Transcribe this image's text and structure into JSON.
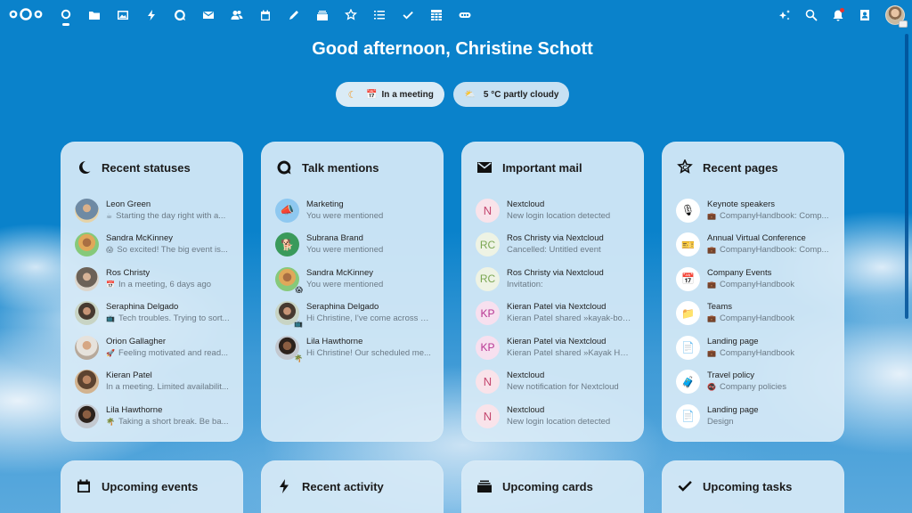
{
  "header": {
    "logo": "nextcloud-logo",
    "apps": [
      {
        "name": "dashboard",
        "icon": "dashboard-icon",
        "active": true
      },
      {
        "name": "files",
        "icon": "folder-icon"
      },
      {
        "name": "photos",
        "icon": "image-icon"
      },
      {
        "name": "activity",
        "icon": "lightning-icon"
      },
      {
        "name": "talk",
        "icon": "talk-icon"
      },
      {
        "name": "mail",
        "icon": "mail-icon"
      },
      {
        "name": "contacts",
        "icon": "contacts-icon"
      },
      {
        "name": "calendar",
        "icon": "calendar-icon"
      },
      {
        "name": "notes",
        "icon": "pencil-icon"
      },
      {
        "name": "deck",
        "icon": "deck-icon"
      },
      {
        "name": "collectives",
        "icon": "collectives-icon"
      },
      {
        "name": "tasks-list",
        "icon": "list-icon"
      },
      {
        "name": "tasks",
        "icon": "check-icon"
      },
      {
        "name": "tables",
        "icon": "table-icon"
      },
      {
        "name": "integrations",
        "icon": "link-icon"
      }
    ],
    "right": [
      "assistant-icon",
      "search-icon",
      "bell-icon",
      "contacts-menu-icon",
      "user-avatar"
    ]
  },
  "greeting": "Good afternoon, Christine Schott",
  "status": {
    "status_label": "In a meeting",
    "weather_label": "5 °C partly cloudy"
  },
  "widgets": {
    "statuses": {
      "title": "Recent statuses",
      "items": [
        {
          "name": "Leon Green",
          "emoji": "☕",
          "text": "Starting the day right with a..."
        },
        {
          "name": "Sandra McKinney",
          "emoji": "😱",
          "text": "So excited! The big event is..."
        },
        {
          "name": "Ros Christy",
          "emoji": "📅",
          "text": "In a meeting, 6 days ago"
        },
        {
          "name": "Seraphina Delgado",
          "emoji": "📺",
          "text": "Tech troubles. Trying to sort..."
        },
        {
          "name": "Orion Gallagher",
          "emoji": "🚀",
          "text": "Feeling motivated and read..."
        },
        {
          "name": "Kieran Patel",
          "emoji": "",
          "text": "In a meeting. Limited availabilit..."
        },
        {
          "name": "Lila Hawthorne",
          "emoji": "🌴",
          "text": "Taking a short break. Be ba..."
        }
      ]
    },
    "talk": {
      "title": "Talk mentions",
      "items": [
        {
          "name": "Marketing",
          "text": "You were mentioned"
        },
        {
          "name": "Subrana Brand",
          "text": "You were mentioned"
        },
        {
          "name": "Sandra McKinney",
          "text": "You were mentioned",
          "badge": "😱"
        },
        {
          "name": "Seraphina Delgado",
          "text": "Hi Christine, I've come across a ...",
          "badge": "📺"
        },
        {
          "name": "Lila Hawthorne",
          "text": "Hi Christine! Our scheduled me...",
          "badge": "🌴"
        }
      ]
    },
    "mail": {
      "title": "Important mail",
      "items": [
        {
          "initials": "N",
          "from": "Nextcloud",
          "subject": "New login location detected"
        },
        {
          "initials": "RC",
          "from": "Ros Christy via Nextcloud",
          "subject": "Cancelled: Untitled event"
        },
        {
          "initials": "RC",
          "from": "Ros Christy via Nextcloud",
          "subject": "Invitation:"
        },
        {
          "initials": "KP",
          "from": "Kieran Patel via Nextcloud",
          "subject": "Kieran Patel shared »kayak-boo..."
        },
        {
          "initials": "KP",
          "from": "Kieran Patel via Nextcloud",
          "subject": "Kieran Patel shared »Kayak Holi..."
        },
        {
          "initials": "N",
          "from": "Nextcloud",
          "subject": "New notification for Nextcloud"
        },
        {
          "initials": "N",
          "from": "Nextcloud",
          "subject": "New login location detected"
        }
      ]
    },
    "pages": {
      "title": "Recent pages",
      "items": [
        {
          "icon": "🎙",
          "title": "Keynote speakers",
          "emoji": "💼",
          "collective": "CompanyHandbook: Comp..."
        },
        {
          "icon": "🎫",
          "title": "Annual Virtual Conference",
          "emoji": "💼",
          "collective": "CompanyHandbook: Comp..."
        },
        {
          "icon": "📅",
          "title": "Company Events",
          "emoji": "💼",
          "collective": "CompanyHandbook"
        },
        {
          "icon": "📁",
          "title": "Teams",
          "emoji": "💼",
          "collective": "CompanyHandbook"
        },
        {
          "icon": "📄",
          "title": "Landing page",
          "emoji": "💼",
          "collective": "CompanyHandbook"
        },
        {
          "icon": "🧳",
          "title": "Travel policy",
          "emoji": "🚭",
          "collective": "Company policies"
        },
        {
          "icon": "📄",
          "title": "Landing page",
          "emoji": "",
          "collective": "Design"
        }
      ]
    },
    "events": {
      "title": "Upcoming events"
    },
    "activity": {
      "title": "Recent activity"
    },
    "cards": {
      "title": "Upcoming cards"
    },
    "tasks": {
      "title": "Upcoming tasks"
    }
  }
}
